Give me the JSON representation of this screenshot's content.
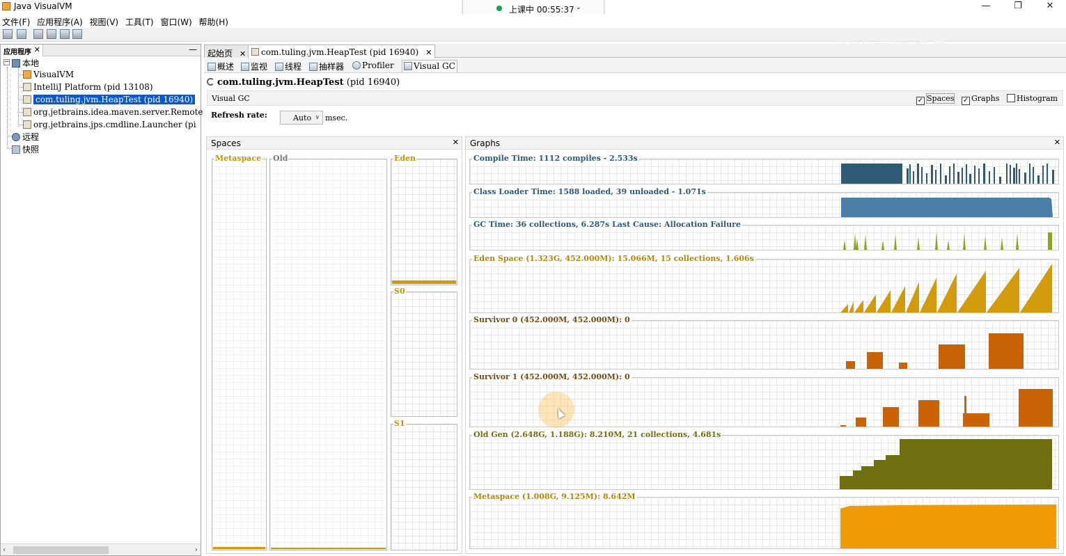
{
  "window": {
    "title": "Java VisualVM",
    "recording_text": "上课中 00:55:37",
    "watermark": "图灵学院诸葛"
  },
  "menu": [
    "文件(F)",
    "应用程序(A)",
    "视图(V)",
    "工具(T)",
    "窗口(W)",
    "帮助(H)"
  ],
  "left": {
    "tab_label": "应用程序",
    "tree": {
      "local": "本地",
      "items": [
        "VisualVM",
        "IntelliJ Platform (pid 13108)",
        "com.tuling.jvm.HeapTest (pid 16940)",
        "org.jetbrains.idea.maven.server.Remote",
        "org.jetbrains.jps.cmdline.Launcher (pi"
      ],
      "remote": "远程",
      "snapshots": "快照"
    }
  },
  "doc_tabs": [
    "起始页",
    "com.tuling.jvm.HeapTest (pid 16940)"
  ],
  "sub_tabs": [
    "概述",
    "监视",
    "线程",
    "抽样器",
    "Profiler",
    "Visual GC"
  ],
  "process": {
    "name": "com.tuling.jvm.HeapTest",
    "pid": "(pid 16940)"
  },
  "visual_gc": {
    "header": "Visual GC",
    "checkboxes": [
      {
        "label": "Spaces",
        "checked": true
      },
      {
        "label": "Graphs",
        "checked": true
      },
      {
        "label": "Histogram",
        "checked": false
      }
    ],
    "refresh_label": "Refresh rate:",
    "refresh_value": "Auto",
    "refresh_unit": "msec."
  },
  "spaces": {
    "title": "Spaces",
    "metaspace": "Metaspace",
    "old": "Old",
    "eden": "Eden",
    "s0": "S0",
    "s1": "S1"
  },
  "graphs": {
    "title": "Graphs",
    "compile": "Compile Time: 1112 compiles - 2.533s",
    "classloader": "Class Loader Time: 1588 loaded, 39 unloaded - 1.071s",
    "gc": "GC Time: 36 collections, 6.287s  Last Cause: Allocation Failure",
    "eden": "Eden Space (1.323G, 452.000M): 15.066M, 15 collections, 1.606s",
    "s0": "Survivor 0 (452.000M, 452.000M): 0",
    "s1": "Survivor 1 (452.000M, 452.000M): 0",
    "old": "Old Gen (2.648G, 1.188G): 8.210M, 21 collections, 4.681s",
    "meta": "Metaspace (1.008G, 9.125M): 8.642M"
  },
  "colors": {
    "compile": "#2f5a73",
    "classloader": "#4a7fa8",
    "gc": "#8aa51f",
    "eden": "#d39a0b",
    "survivor": "#c96305",
    "oldgen": "#6f6f10",
    "metaspace": "#f09a05",
    "label_default": "#2a5a80",
    "label_accent": "#b8860b",
    "label_survivor": "#7a4a10"
  }
}
